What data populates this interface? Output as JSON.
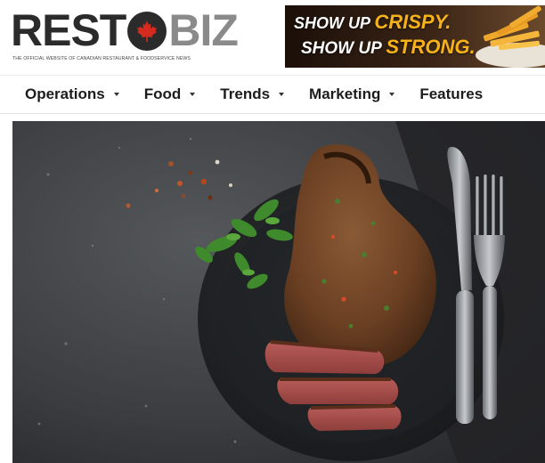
{
  "header": {
    "logo": {
      "part1": "REST",
      "part2": "BIZ",
      "tagline": "THE OFFICIAL WEBSITE OF CANADIAN RESTAURANT & FOODSERVICE NEWS",
      "icon": "maple-leaf-icon"
    },
    "ad": {
      "line1_a": "SHOW UP ",
      "line1_b": "CRISPY.",
      "line2_a": "SHOW UP ",
      "line2_b": "STRONG."
    }
  },
  "nav": {
    "items": [
      {
        "label": "Operations",
        "has_dropdown": true
      },
      {
        "label": "Food",
        "has_dropdown": true
      },
      {
        "label": "Trends",
        "has_dropdown": true
      },
      {
        "label": "Marketing",
        "has_dropdown": true
      },
      {
        "label": "Features",
        "has_dropdown": false
      }
    ]
  },
  "hero": {
    "subject": "steak-on-plate-image"
  },
  "colors": {
    "logo_dark": "#2b2b2b",
    "logo_grey": "#8a8a8a",
    "maple_red": "#d52b1e",
    "ad_accent": "#f6b21a",
    "nav_text": "#1c1c1c"
  }
}
